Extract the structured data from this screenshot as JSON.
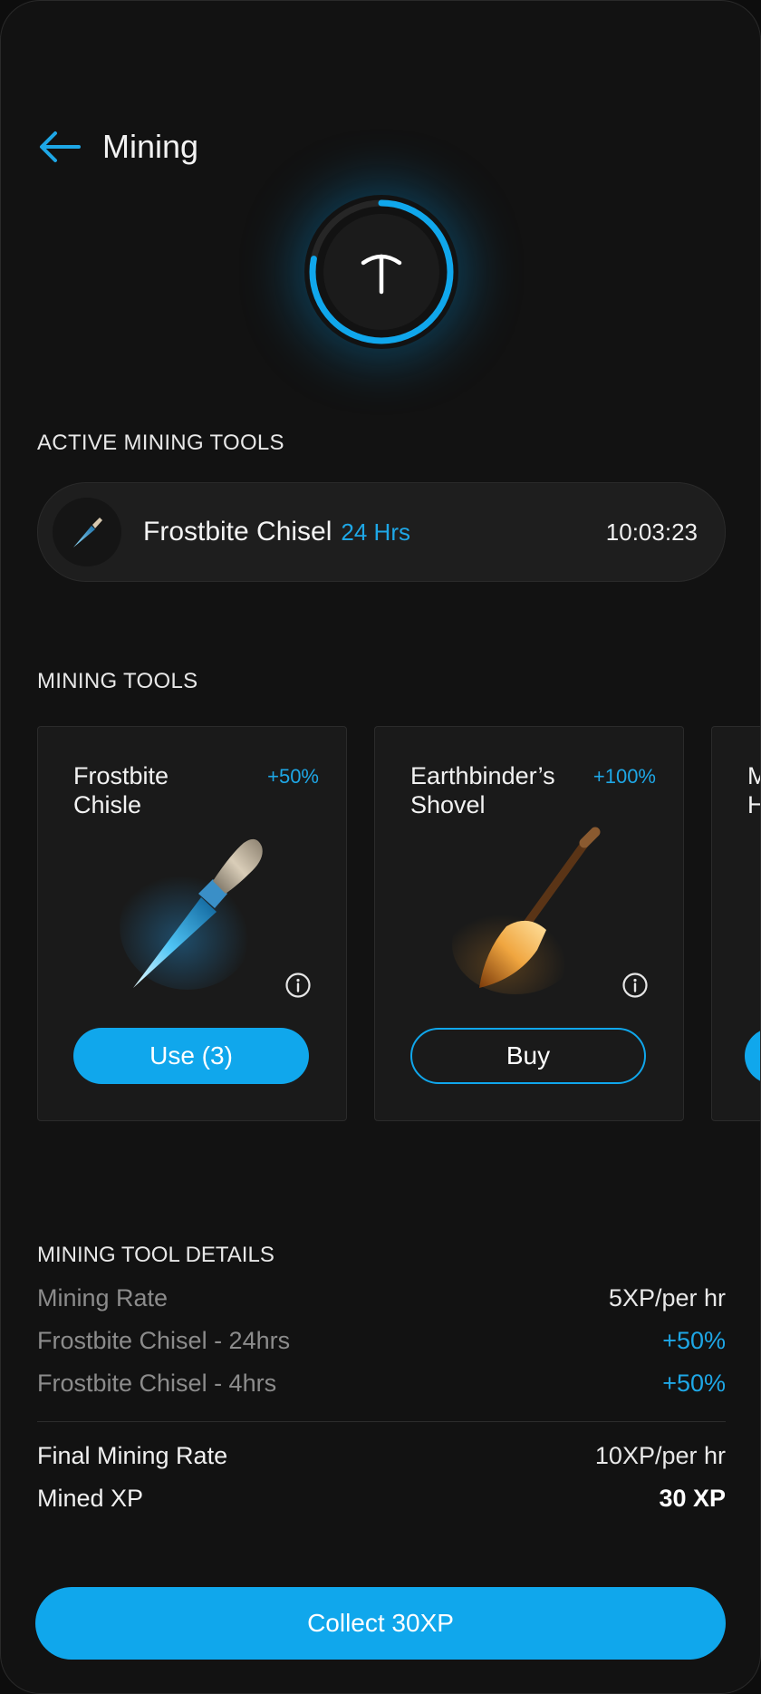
{
  "header": {
    "title": "Mining",
    "back_icon": "arrow-left-icon"
  },
  "hero": {
    "icon": "pickaxe-icon",
    "progress": 0.78,
    "accent": "#10a7ec"
  },
  "active_section": {
    "title": "ACTIVE MINING TOOLS",
    "tool": {
      "name": "Frostbite Chisel",
      "duration": "24 Hrs",
      "timer": "10:03:23",
      "icon": "chisel-icon"
    }
  },
  "tools_section": {
    "title": "MINING TOOLS",
    "cards": [
      {
        "name": "Frostbite Chisle",
        "bonus": "+50%",
        "button": "Use (3)",
        "icon": "chisel-icon"
      },
      {
        "name": "Earthbinder’s Shovel",
        "bonus": "+100%",
        "button": "Buy",
        "icon": "shovel-icon"
      },
      {
        "name": "M\nH",
        "bonus": "",
        "button": "",
        "icon": ""
      }
    ]
  },
  "details": {
    "title": "MINING TOOL DETAILS",
    "rows": [
      {
        "label": "Mining Rate",
        "value": "5XP/per hr"
      },
      {
        "label": "Frostbite Chisel - 24hrs",
        "value": "+50%"
      },
      {
        "label": "Frostbite Chisel - 4hrs",
        "value": "+50%"
      }
    ],
    "final": [
      {
        "label": "Final Mining Rate",
        "value": "10XP/per hr"
      },
      {
        "label": "Mined XP",
        "value": "30 XP"
      }
    ]
  },
  "collect": {
    "label": "Collect 30XP"
  },
  "colors": {
    "accent": "#10a7ec",
    "background": "#121212",
    "card": "#1a1a1a"
  }
}
